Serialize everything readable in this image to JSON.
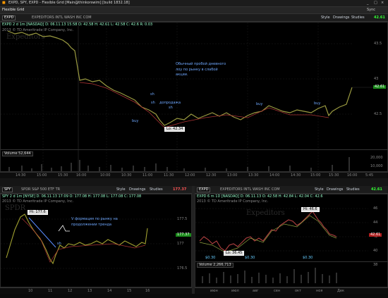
{
  "window": {
    "title": "EXPD, SPY, EXPD - Flexible Grid [Main@thinkorswim] [build 1832.18]"
  },
  "toolbar": {
    "tab": "Flexible Grid",
    "sync": "Sync",
    "minimize": "_",
    "maximize": "□",
    "close": "×"
  },
  "main": {
    "symbol": "EXPD",
    "header_info": "EXPEDITORS INTL WASH INC COM",
    "style": "Style",
    "drawings": "Drawings",
    "studies": "Studies",
    "price_tag": "42.61",
    "chart_info": "EXPD 2 d 1m [NASDAQ]   D: 06.11.13 15:58   O: 42.58   H: 42.61   L: 42.58   C: 42.6   R: 0.03",
    "copyright": "2013 © TD Ameritrade IP Company, Inc.",
    "watermark": "Expeditors",
    "annotation": [
      "Обычный пробой дневного",
      "лоу по рынку в слабой",
      "акции."
    ],
    "labels": {
      "sh1": "sh",
      "sh2": "sh",
      "sh3": "sh",
      "add": "допродажа",
      "buy1": "buy",
      "buy2": "buy",
      "buy3": "buy"
    },
    "lo_label": "Lo: 42.34",
    "price_ticks": [
      "43.5",
      "43",
      "42.5"
    ],
    "price_box": "42.61",
    "volume_label": "Volume  52,644",
    "volume_ticks": [
      "20,000",
      "10,000"
    ],
    "time_ticks": [
      "14:30",
      "15:00",
      "15:30",
      "16:00",
      "10:00",
      "10:30",
      "11:00",
      "11:30",
      "12:00",
      "12:30",
      "13:00",
      "13:30",
      "14:00",
      "14:30",
      "15:00",
      "15:30",
      "16:00",
      "5:45"
    ]
  },
  "left": {
    "symbol": "SPY",
    "header_info": "SPDR S&P 500 ETF TR",
    "style": "Style",
    "drawings": "Drawings",
    "studies": "Studies",
    "price_tag": "177.37",
    "chart_info": "SPY 2 d 1m [NYSE]   D: 06.11.13 17:09   O: 177.08   H: 177.08   L: 177.08   C: 177.08",
    "copyright": "2013 © TD Ameritrade IP Company, Inc.",
    "watermark": "SPDR",
    "hi_label": "Hi: 177.6",
    "annotation": [
      "V формация по рынку на",
      "продолжении тренда"
    ],
    "sh": "sh",
    "price_ticks": [
      "177.5",
      "177",
      "176.5"
    ],
    "price_box": "177.37",
    "time_ticks": [
      "10",
      "11",
      "12",
      "13",
      "14",
      "15",
      "16"
    ]
  },
  "right": {
    "symbol": "EXPD",
    "header_info": "EXPEDITORS INTL WASH INC COM",
    "style": "Style",
    "drawings": "Drawings",
    "studies": "Studies",
    "price_tag": "42.61",
    "chart_info": "EXPD 6 m 1D [NASDAQ]   D: 06.11.13   O: 42.58   H: 42.84   L: 42.04   C: 42.6",
    "copyright": "2013 © TD Ameritrade IP Company, Inc.",
    "watermark": "Expeditors",
    "hi_label": "Hi: 46.6",
    "lo_label": "Lo: 36.45",
    "price_ticks": [
      "46",
      "44",
      "42",
      "40",
      "38"
    ],
    "price_box": "42.61",
    "volume_label": "Volume  2,266,713",
    "time_ticks": [
      "июн",
      "июл",
      "авг",
      "сен",
      "окт",
      "ноя",
      "Дек"
    ],
    "badges": [
      "$0.30",
      "$0.30",
      "$0.30"
    ]
  }
}
